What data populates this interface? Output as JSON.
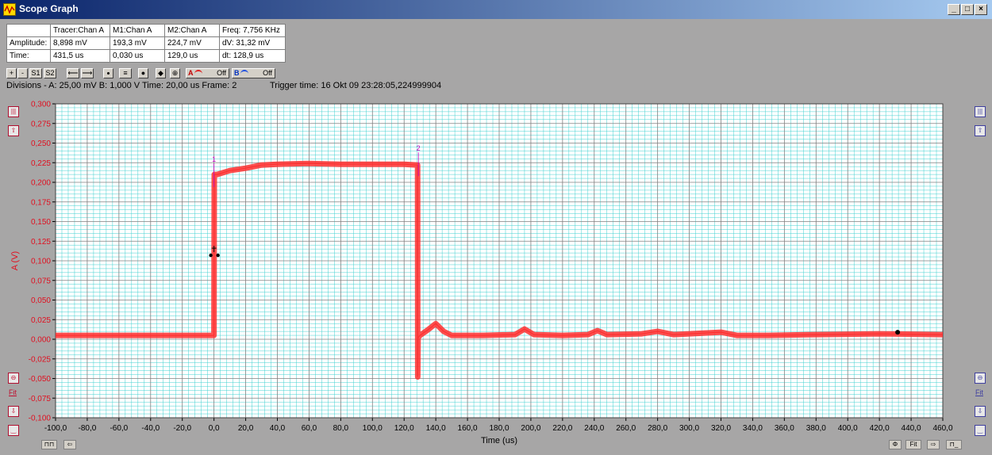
{
  "window": {
    "title": "Scope Graph",
    "minimize_label": "_",
    "maximize_label": "□",
    "close_label": "×"
  },
  "info_table": {
    "header": [
      "",
      "Tracer:Chan A",
      "M1:Chan A",
      "M2:Chan A",
      "Freq: 7,756 KHz"
    ],
    "rows": [
      [
        "Amplitude:",
        "8,898 mV",
        "193,3 mV",
        "224,7 mV",
        "dV: 31,32 mV"
      ],
      [
        "Time:",
        "431,5 us",
        "0,030 us",
        "129,0 us",
        "dt:  128,9 us"
      ]
    ]
  },
  "toolbar": {
    "zoom_in": "+",
    "zoom_out": "-",
    "s1": "S1",
    "s2": "S2",
    "left_arrow": "⟵",
    "right_arrow": "⟶",
    "chan_a_label": "A",
    "chan_a_state": "Off",
    "chan_b_label": "B",
    "chan_b_state": "Off"
  },
  "status": {
    "divisions": "Divisions -  A: 25,00 mV   B: 1,000 V   Time: 20,00 us   Frame: 2",
    "trigger": "Trigger time: 16 Okt 09 23:28:05,224999904"
  },
  "side_controls": {
    "fit_label": "Fit"
  },
  "bottom_controls": {
    "fit_label": "Fit"
  },
  "colors": {
    "trace": "#ff3030",
    "axis_text": "#e01020",
    "grid_major": "#808080",
    "grid_minor": "#40d0d0",
    "marker": "#c000c0"
  },
  "chart_data": {
    "type": "line",
    "xlabel": "Time (us)",
    "ylabel": "A (V)",
    "xlim": [
      -100,
      460
    ],
    "ylim": [
      -0.1,
      0.3
    ],
    "x_ticks": [
      "-100,0",
      "-80,0",
      "-60,0",
      "-40,0",
      "-20,0",
      "0,0",
      "20,0",
      "40,0",
      "60,0",
      "80,0",
      "100,0",
      "120,0",
      "140,0",
      "160,0",
      "180,0",
      "200,0",
      "220,0",
      "240,0",
      "260,0",
      "280,0",
      "300,0",
      "320,0",
      "340,0",
      "360,0",
      "380,0",
      "400,0",
      "420,0",
      "440,0",
      "460,0"
    ],
    "y_ticks": [
      "0,300",
      "0,275",
      "0,250",
      "0,225",
      "0,200",
      "0,175",
      "0,150",
      "0,125",
      "0,100",
      "0,075",
      "0,050",
      "0,025",
      "0,000",
      "-0,025",
      "-0,050",
      "-0,075",
      "-0,100"
    ],
    "grid": true,
    "series": [
      {
        "x": [
          -100,
          -50,
          0,
          0.2,
          2,
          10,
          20,
          30,
          40,
          60,
          80,
          100,
          120,
          128.5,
          128.6,
          128.8,
          130,
          135,
          140,
          145,
          150,
          170,
          190,
          196,
          202,
          220,
          236,
          242,
          248,
          270,
          280,
          290,
          310,
          320,
          330,
          350,
          380,
          420,
          460
        ],
        "y": [
          0.005,
          0.005,
          0.005,
          0.21,
          0.21,
          0.215,
          0.218,
          0.222,
          0.223,
          0.224,
          0.223,
          0.223,
          0.223,
          0.222,
          -0.048,
          0.002,
          0.005,
          0.012,
          0.02,
          0.01,
          0.005,
          0.005,
          0.006,
          0.013,
          0.006,
          0.005,
          0.006,
          0.011,
          0.006,
          0.007,
          0.01,
          0.006,
          0.008,
          0.009,
          0.005,
          0.005,
          0.006,
          0.007,
          0.006
        ]
      }
    ],
    "markers": [
      {
        "label": "1",
        "x": 0,
        "y": 0.21
      },
      {
        "label": "2",
        "x": 129,
        "y": 0.224
      }
    ],
    "tracer": {
      "x": 431.5,
      "y": 0.009
    }
  }
}
